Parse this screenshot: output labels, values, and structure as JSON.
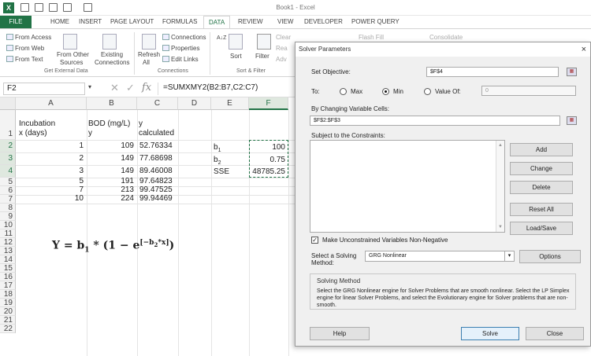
{
  "window": {
    "title": "Book1 - Excel"
  },
  "ribbon_tabs": [
    "FILE",
    "HOME",
    "INSERT",
    "PAGE LAYOUT",
    "FORMULAS",
    "DATA",
    "REVIEW",
    "VIEW",
    "DEVELOPER",
    "POWER QUERY"
  ],
  "ribbon": {
    "from_access": "From Access",
    "from_web": "From Web",
    "from_text": "From Text",
    "from_other": "From Other",
    "sources": "Sources",
    "existing": "Existing",
    "connections_btn": "Connections",
    "refresh": "Refresh",
    "all": "All",
    "connections": "Connections",
    "properties": "Properties",
    "edit_links": "Edit Links",
    "sort": "Sort",
    "filter": "Filter",
    "clear": "Clear",
    "reapply": "Rea",
    "advanced": "Adv",
    "flash_fill": "Flash Fill",
    "consolidate": "Consolidate",
    "group_external": "Get External Data",
    "group_connections": "Connections",
    "group_sort": "Sort & Filter"
  },
  "formula_bar": {
    "name_box": "F2",
    "fx": "fx",
    "formula": "=SUMXMY2(B2:B7,C2:C7)"
  },
  "sheet": {
    "columns": [
      "A",
      "B",
      "C",
      "D",
      "E",
      "F"
    ],
    "rows": [
      "1",
      "2",
      "3",
      "4",
      "5",
      "6",
      "7",
      "8",
      "9",
      "10",
      "11",
      "12",
      "13",
      "14",
      "15",
      "16",
      "17",
      "18",
      "19",
      "20",
      "21",
      "22"
    ],
    "a1_line1": "Incubation",
    "a1_line2": "x (days)",
    "b1_line1": "BOD (mg/L)",
    "b1_line2": "y",
    "c1_line1": "y",
    "c1_line2": "calculated",
    "x_values": [
      "1",
      "2",
      "3",
      "5",
      "7",
      "10"
    ],
    "y_values": [
      "109",
      "149",
      "149",
      "191",
      "213",
      "224"
    ],
    "y_calc": [
      "52.76334",
      "77.68698",
      "89.46008",
      "97.64823",
      "99.47525",
      "99.94469"
    ],
    "e_labels": [
      "b",
      "b",
      "SSE"
    ],
    "e_subs": [
      "1",
      "2",
      ""
    ],
    "f_values": [
      "100",
      "0.75",
      "48785.25"
    ],
    "equation": {
      "lhs": "Y = b",
      "sub1": "1",
      "mid": " * (1 − e",
      "exp": "[−b",
      "expsub": "2",
      "exp_end": "*x]",
      "close": ")"
    }
  },
  "solver": {
    "title": "Solver Parameters",
    "close": "×",
    "set_objective_label": "Set Objective:",
    "set_objective_value": "$F$4",
    "to_label": "To:",
    "max_label": "Max",
    "min_label": "Min",
    "value_of_label": "Value Of:",
    "value_of_value": "0",
    "selected_goal": "min",
    "changing_label": "By Changing Variable Cells:",
    "changing_value": "$F$2:$F$3",
    "constraints_label": "Subject to the Constraints:",
    "add": "Add",
    "change": "Change",
    "delete": "Delete",
    "reset_all": "Reset All",
    "load_save": "Load/Save",
    "nonneg_label": "Make Unconstrained Variables Non-Negative",
    "nonneg_checked": true,
    "method_label_1": "Select a Solving",
    "method_label_2": "Method:",
    "method_value": "GRG Nonlinear",
    "options": "Options",
    "solving_method_title": "Solving Method",
    "solving_method_text": "Select the GRG Nonlinear engine for Solver Problems that are smooth nonlinear. Select the LP Simplex engine for linear Solver Problems, and select the Evolutionary engine for Solver problems that are non-smooth.",
    "help": "Help",
    "solve": "Solve",
    "close_btn": "Close"
  }
}
